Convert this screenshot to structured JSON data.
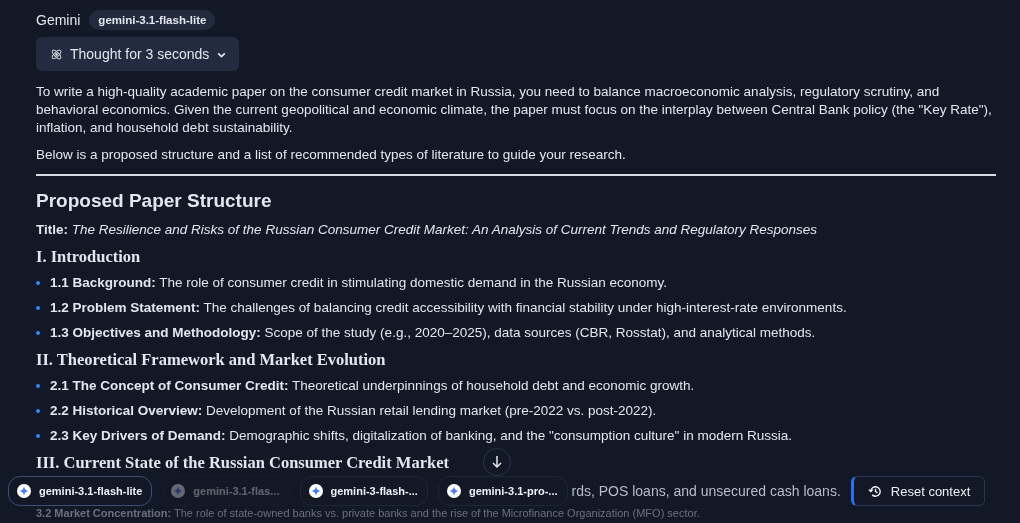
{
  "header": {
    "name": "Gemini",
    "model_badge": "gemini-3.1-flash-lite"
  },
  "thought_toggle": {
    "label": "Thought for 3 seconds",
    "expanded": false
  },
  "intro": [
    "To write a high-quality academic paper on the consumer credit market in Russia, you need to balance macroeconomic analysis, regulatory scrutiny, and behavioral economics. Given the current geopolitical and economic climate, the paper must focus on the interplay between Central Bank policy (the \"Key Rate\"), inflation, and household debt sustainability.",
    "Below is a proposed structure and a list of recommended types of literature to guide your research."
  ],
  "heading": "Proposed Paper Structure",
  "title_line": "**Title:** *The Resilience and Risks of the Russian Consumer Credit Market: An Analysis of Current Trends and Regulatory Responses*",
  "sections": [
    {
      "heading": "I. Introduction",
      "items": [
        "**1.1 Background:** The role of consumer credit in stimulating domestic demand in the Russian economy.",
        "**1.2 Problem Statement:** The challenges of balancing credit accessibility with financial stability under high-interest-rate environments.",
        "**1.3 Objectives and Methodology:** Scope of the study (e.g., 2020–2025), data sources (CBR, Rosstat), and analytical methods."
      ]
    },
    {
      "heading": "II. Theoretical Framework and Market Evolution",
      "items": [
        "**2.1 The Concept of Consumer Credit:** Theoretical underpinnings of household debt and economic growth.",
        "**2.2 Historical Overview:** Development of the Russian retail lending market (pre-2022 vs. post-2022).",
        "**2.3 Key Drivers of Demand:** Demographic shifts, digitalization of banking, and the \"consumption culture\" in modern Russia."
      ]
    },
    {
      "heading": "III. Current State of the Russian Consumer Credit Market"
    }
  ],
  "model_chips": [
    {
      "label": "gemini-3.1-flash-lite",
      "selected": true,
      "disabled": false
    },
    {
      "label": "gemini-3.1-flas...",
      "selected": false,
      "disabled": true
    },
    {
      "label": "gemini-3-flash-...",
      "selected": false,
      "disabled": false
    },
    {
      "label": "gemini-3.1-pro-...",
      "selected": false,
      "disabled": false
    }
  ],
  "obscured_text": "rds, POS loans, and unsecured cash loans.",
  "reset_button": "Reset context",
  "faded_line": "**3.2 Market Concentration:** The role of state-owned banks vs. private banks and the rise of the Microfinance Organization (MFO) sector."
}
